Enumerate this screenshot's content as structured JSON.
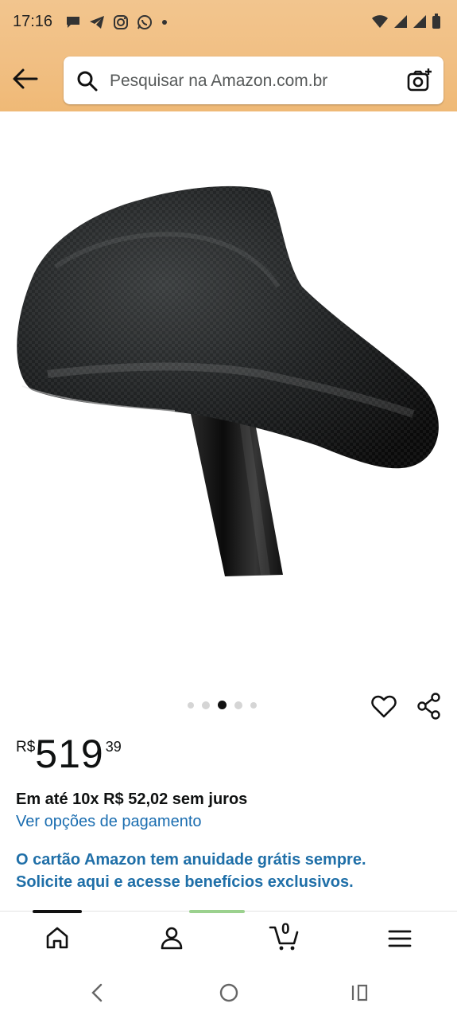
{
  "status": {
    "time": "17:16"
  },
  "search": {
    "placeholder": "Pesquisar na Amazon.com.br"
  },
  "product": {
    "price": {
      "currency": "R$",
      "whole": "519",
      "fraction": "39"
    },
    "installments": "Em até 10x R$ 52,02 sem juros",
    "payment_link": "Ver opções de pagamento",
    "promo_line1": "O cartão Amazon tem anuidade grátis sempre.",
    "promo_line2": "Solicite aqui e acesse benefícios exclusivos."
  },
  "carousel": {
    "count": 5,
    "active_index": 2
  },
  "cart": {
    "count": "0"
  },
  "icons": {
    "back": "arrow-left-icon",
    "search": "search-icon",
    "camera": "camera-icon",
    "wishlist": "heart-icon",
    "share": "share-icon",
    "home": "home-icon",
    "account": "user-icon",
    "cart": "cart-icon",
    "menu": "menu-icon"
  },
  "colors": {
    "header": "#f1bf83",
    "link": "#1a6db0",
    "promo": "#1f6fa8"
  }
}
